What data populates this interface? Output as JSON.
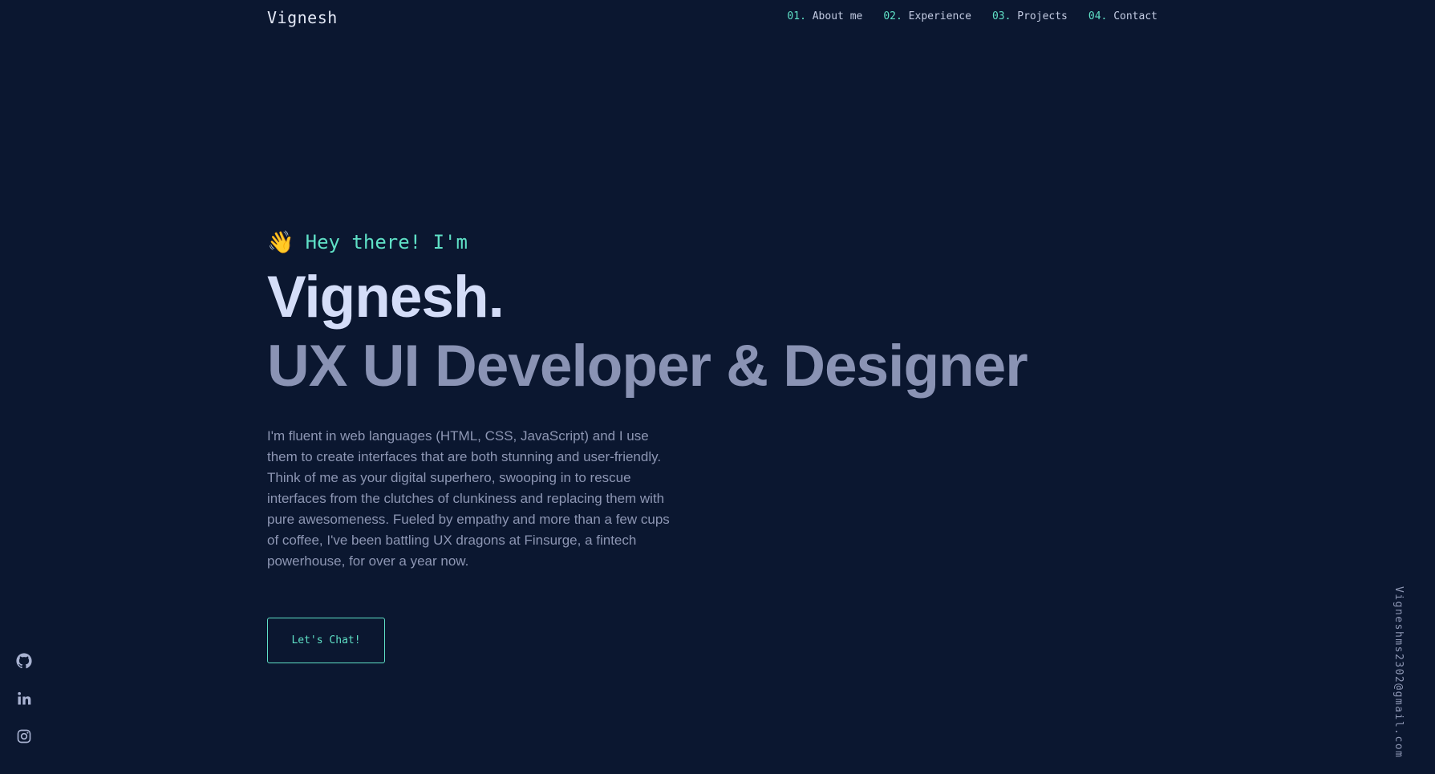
{
  "header": {
    "logo": "Vignesh",
    "nav": [
      {
        "num": "01.",
        "label": "About me"
      },
      {
        "num": "02.",
        "label": "Experience"
      },
      {
        "num": "03.",
        "label": "Projects"
      },
      {
        "num": "04.",
        "label": "Contact"
      }
    ]
  },
  "hero": {
    "wave_icon": "👋",
    "greeting": "Hey there! I'm",
    "name": "Vignesh.",
    "role": "UX UI Developer & Designer",
    "bio": "I'm fluent in web languages (HTML, CSS, JavaScript) and I use them to create interfaces that are both stunning and user-friendly. Think of me as your digital superhero, swooping in to rescue interfaces from the clutches of clunkiness and replacing them with pure awesomeness. Fueled by empathy and more than a few cups of coffee, I've been battling UX dragons at Finsurge, a fintech powerhouse, for over a year now.",
    "cta_label": "Let's Chat!"
  },
  "social": {
    "icons": [
      "github-icon",
      "linkedin-icon",
      "instagram-icon"
    ]
  },
  "email": "Vigneshms2302@gmail.com",
  "colors": {
    "background": "#0b1730",
    "accent": "#5fe0c6",
    "heading": "#d4ddf8",
    "muted": "#8a93b4"
  }
}
